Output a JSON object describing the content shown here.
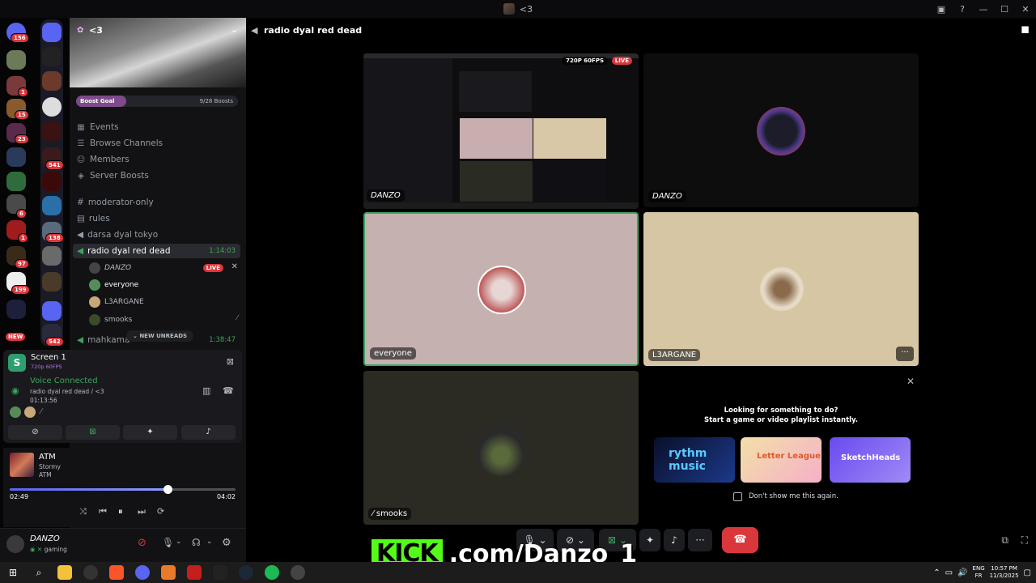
{
  "window": {
    "title": "<3"
  },
  "server": {
    "name": "<3",
    "boost_goal_label": "Boost Goal",
    "boost_count": "9/28 Boosts",
    "nav": [
      "Events",
      "Browse Channels",
      "Members",
      "Server Boosts"
    ],
    "channels": [
      {
        "name": "moderator-only"
      },
      {
        "name": "rules"
      },
      {
        "name": "darsa dyal tokyo"
      },
      {
        "name": "radio dyal red dead",
        "duration": "1:14:03"
      },
      {
        "name": "mahkama",
        "duration": "1:38:47"
      }
    ],
    "voice_users": [
      {
        "name": "DANZO",
        "badge": "LIVE"
      },
      {
        "name": "everyone"
      },
      {
        "name": "L3ARGANE"
      },
      {
        "name": "smooks"
      }
    ],
    "new_unreads": "NEW UNREADS"
  },
  "rail_badges": [
    "156",
    "1",
    "15",
    "23",
    "541",
    "6",
    "1",
    "138",
    "97",
    "199",
    "NEW",
    "542"
  ],
  "voice_panel": {
    "stream_title": "Screen 1",
    "stream_quality": "720p 60FPS",
    "status": "Voice Connected",
    "location": "radio dyal red dead / <3",
    "elapsed": "01:13:56"
  },
  "music": {
    "title": "ATM",
    "artist": "Stormy",
    "album": "ATM",
    "position": "02:49",
    "length": "04:02",
    "progress": 0.7
  },
  "user": {
    "name": "DANZO",
    "status": "gaming"
  },
  "main": {
    "channel_title": "radio dyal red dead",
    "tiles": [
      {
        "name": "DANZO",
        "quality": "720P 60FPS",
        "live": "LIVE"
      },
      {
        "name": "DANZO"
      },
      {
        "name": "everyone"
      },
      {
        "name": "L3ARGANE"
      },
      {
        "name": "smooks"
      }
    ],
    "promo": {
      "line1": "Looking for something to do?",
      "line2": "Start a game or video playlist instantly.",
      "checkbox_label": "Don't show me this again.",
      "cards": [
        "rythm music",
        "Letter League",
        "SketchHeads"
      ]
    }
  },
  "overlay": {
    "kick": "KICK",
    "url": ".com/Danzo_1"
  },
  "taskbar": {
    "lang1": "ENG",
    "lang2": "FR",
    "time": "10:57 PM",
    "date": "11/3/2025"
  },
  "colors": {
    "accent": "#5865f2",
    "danger": "#da373c",
    "online": "#3ba55c",
    "kick": "#53fc18"
  }
}
